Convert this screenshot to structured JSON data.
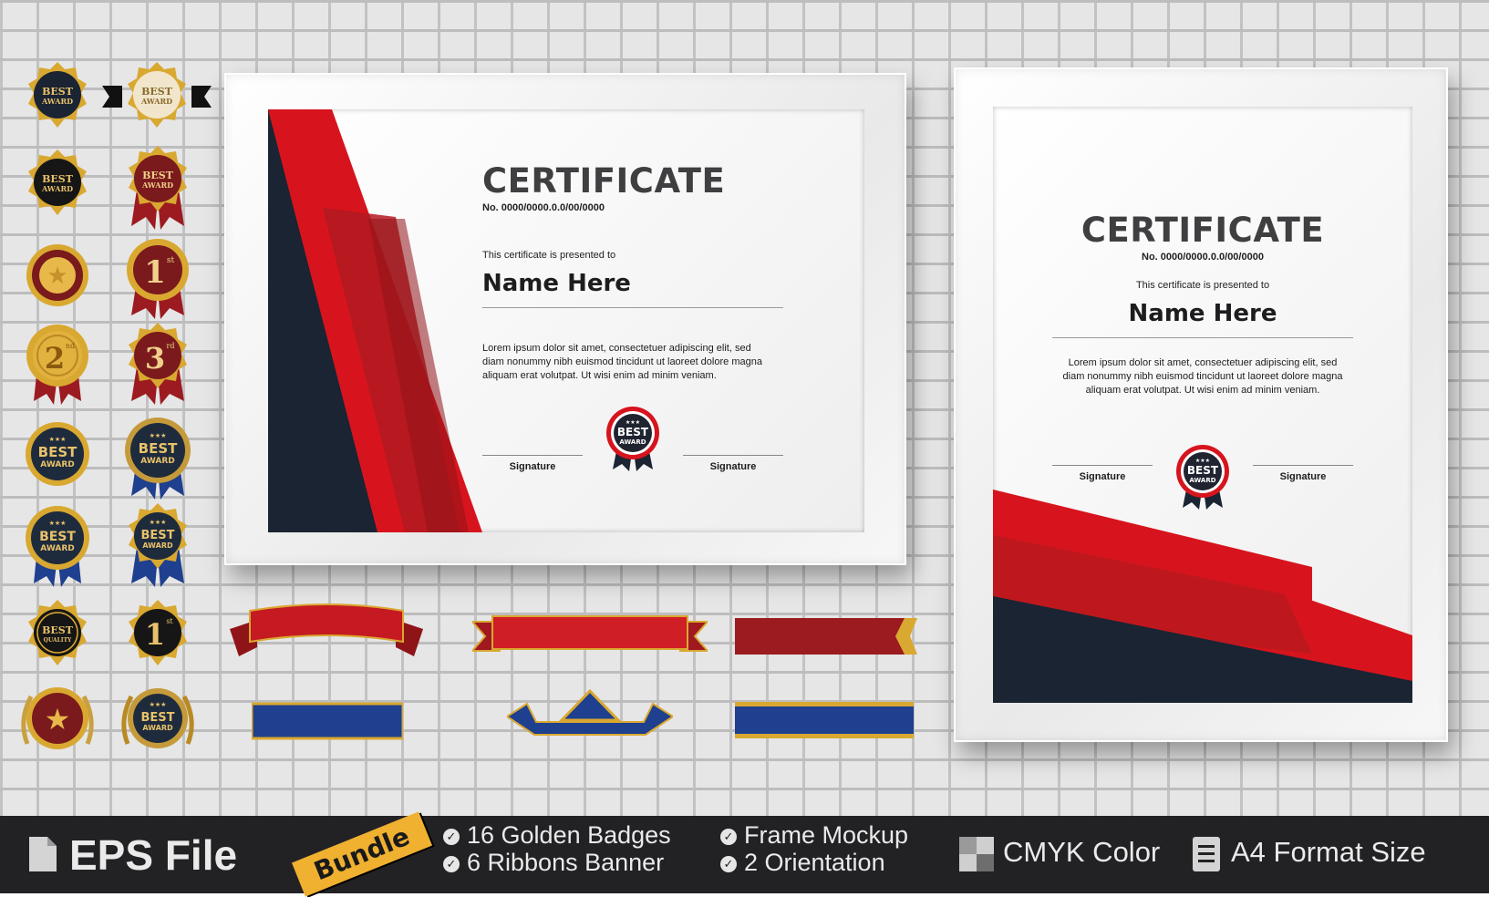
{
  "landscape_certificate": {
    "title": "CERTIFICATE",
    "number": "No. 0000/0000.0.0/00/0000",
    "presented_text": "This certificate is presented to",
    "recipient": "Name Here",
    "body_line1": "Lorem ipsum dolor sit amet, consectetuer adipiscing elit, sed",
    "body_line2": "diam nonummy nibh euismod tincidunt ut laoreet dolore magna",
    "body_line3": "aliquam erat volutpat. Ut wisi enim ad minim veniam.",
    "signature_left": "Signature",
    "signature_right": "Signature",
    "seal_top": "BEST",
    "seal_bottom": "AWARD"
  },
  "portrait_certificate": {
    "title": "CERTIFICATE",
    "number": "No. 0000/0000.0.0/00/0000",
    "presented_text": "This certificate is presented to",
    "recipient": "Name Here",
    "body_line1": "Lorem ipsum dolor sit amet, consectetuer adipiscing elit, sed",
    "body_line2": "diam nonummy nibh euismod tincidunt ut laoreet dolore magna",
    "body_line3": "aliquam erat volutpat. Ut wisi enim ad minim veniam.",
    "signature_left": "Signature",
    "signature_right": "Signature",
    "seal_top": "BEST",
    "seal_bottom": "AWARD"
  },
  "badges": {
    "best": "BEST",
    "award": "AWARD",
    "quality": "QUALITY",
    "first": "1",
    "first_suffix": "st",
    "second": "2",
    "second_suffix": "nd",
    "third": "3",
    "third_suffix": "rd",
    "star": "★",
    "stars": "★★★"
  },
  "colors": {
    "red": "#d7141d",
    "dark_red": "#9b1b20",
    "navy": "#1a2433",
    "blue": "#1f3f8f",
    "gold": "#d9a830",
    "footer_bg": "#222225",
    "bundle_tag": "#f0b030"
  },
  "footer": {
    "file_icon": "file-icon",
    "file_label": "EPS File",
    "bundle_label": "Bundle",
    "feature1": "16 Golden Badges",
    "feature2": "6  Ribbons Banner",
    "feature3": "Frame Mockup",
    "feature4": "2 Orientation",
    "check": "✓",
    "cmyk_label": "CMYK Color",
    "a4_label": "A4 Format Size"
  }
}
